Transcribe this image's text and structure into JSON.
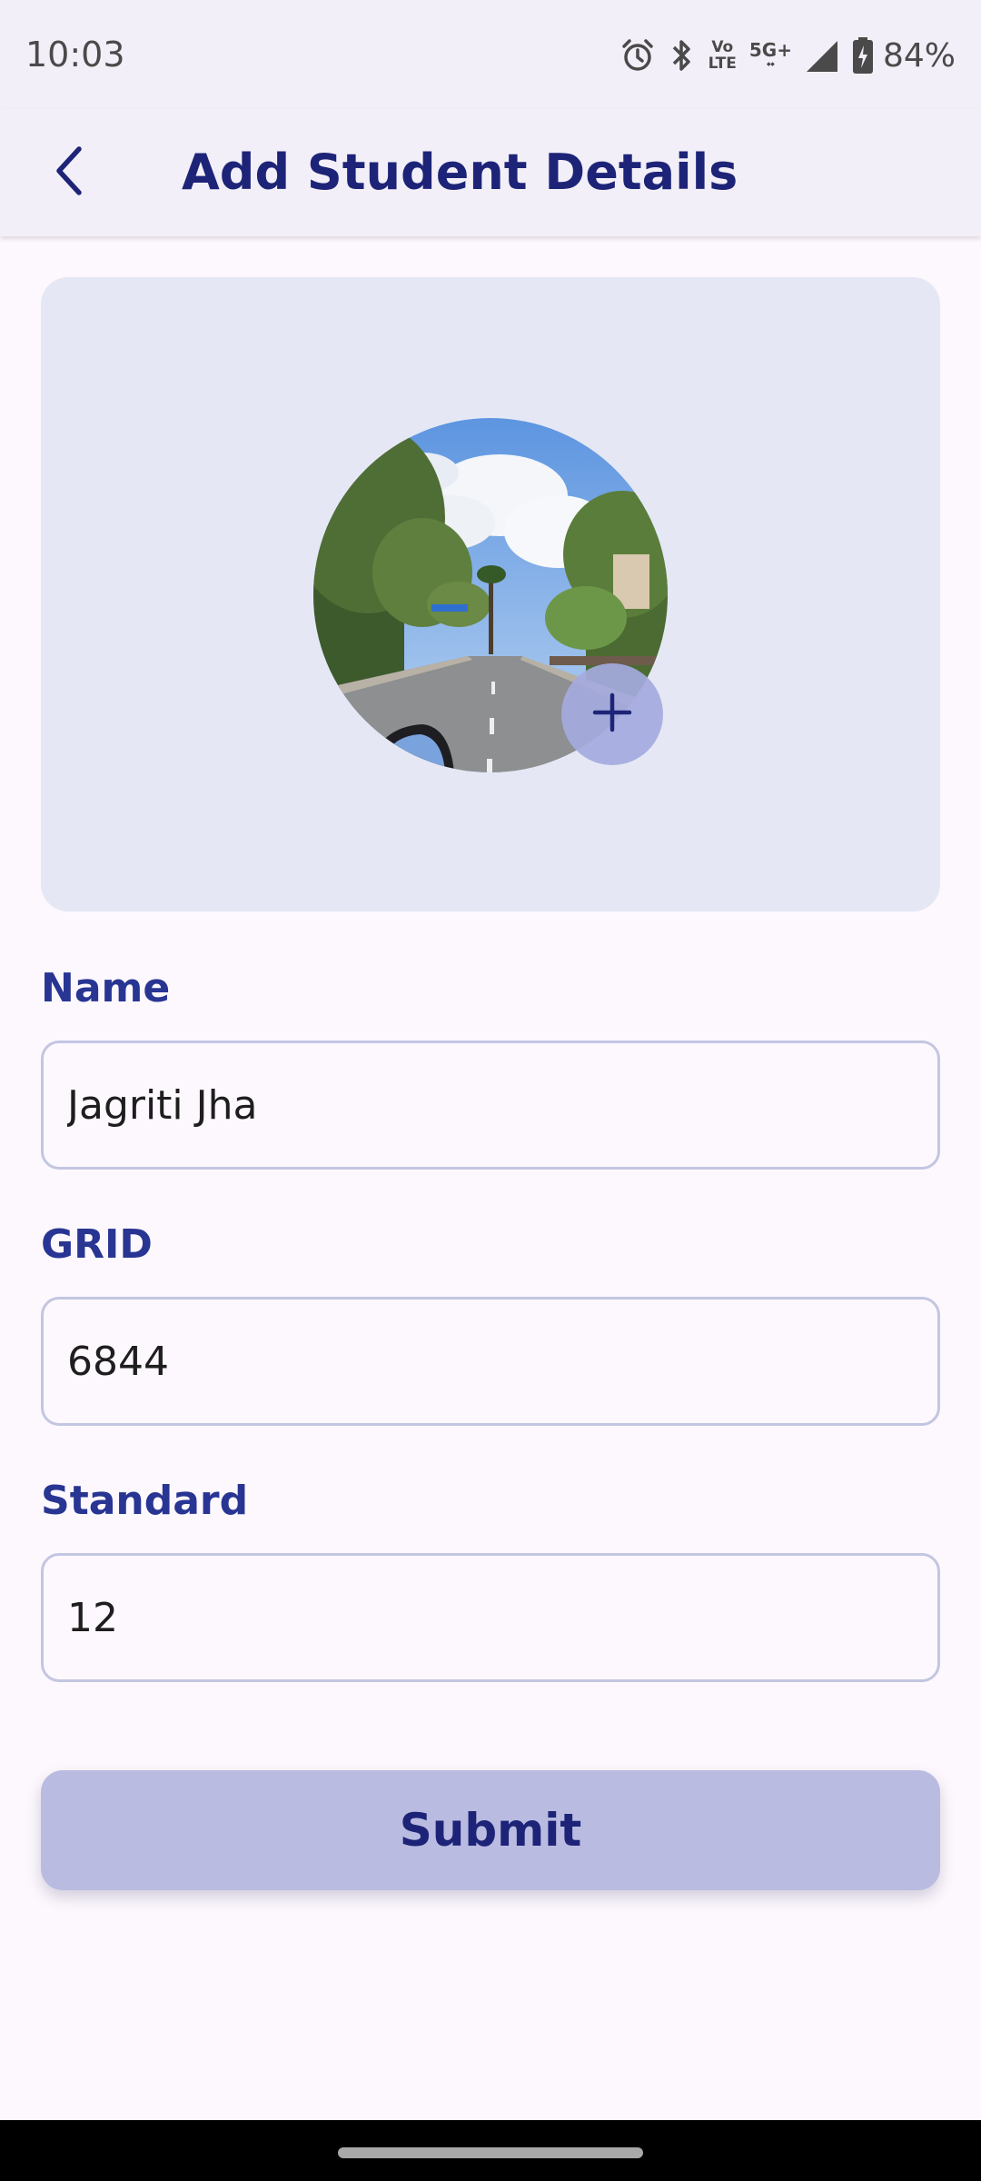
{
  "status_bar": {
    "time": "10:03",
    "network_volte": [
      "Vo",
      "LTE"
    ],
    "network_5g": "5G+",
    "battery_percent": "84%",
    "icons": [
      "alarm-icon",
      "bluetooth-icon",
      "volte-icon",
      "5g-icon",
      "signal-icon",
      "battery-charging-icon"
    ]
  },
  "app_bar": {
    "title": "Add Student Details",
    "back_icon": "arrow-back-icon"
  },
  "photo": {
    "description_icon": "profile-photo",
    "add_icon": "plus-icon"
  },
  "form": {
    "name": {
      "label": "Name",
      "value": "Jagriti Jha"
    },
    "grid": {
      "label": "GRID",
      "value": "6844"
    },
    "standard": {
      "label": "Standard",
      "value": "12"
    },
    "submit_label": "Submit"
  },
  "colors": {
    "accent": "#283593",
    "title": "#1d2478",
    "card_bg": "#e5e8f4",
    "button_bg": "#b9bbe1",
    "field_border": "#c3c6e2",
    "background": "#fdf8fd"
  }
}
